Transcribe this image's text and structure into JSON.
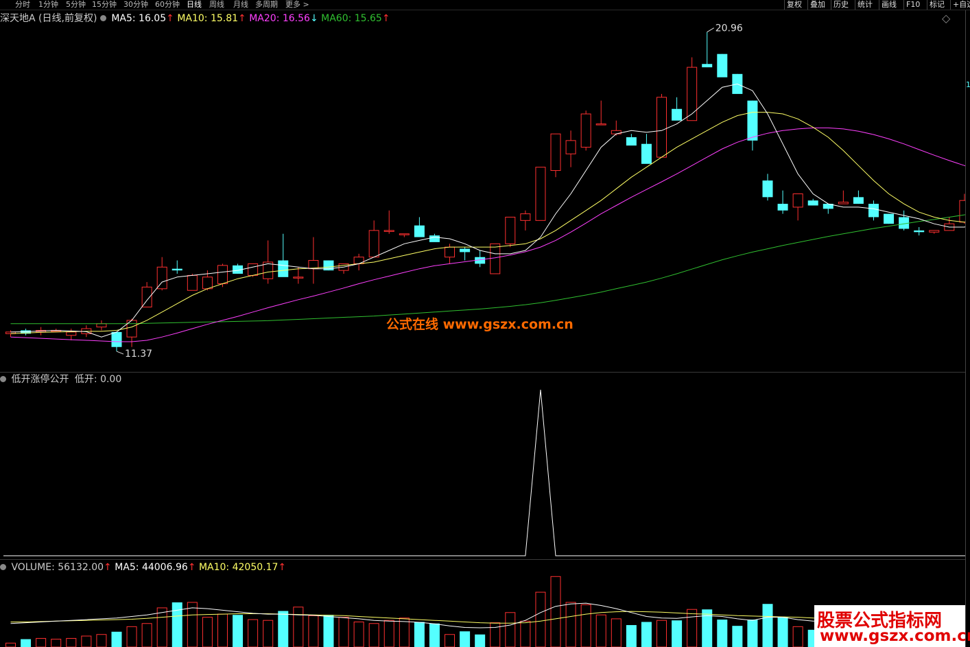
{
  "topbar": {
    "tabs": [
      "分时",
      "1分钟",
      "5分钟",
      "15分钟",
      "30分钟",
      "60分钟",
      "日线",
      "周线",
      "月线",
      "多周期",
      "更多 >"
    ],
    "active_tab": "日线",
    "right_buttons": [
      "复权",
      "叠加",
      "历史",
      "统计",
      "画线",
      "F10",
      "标记",
      "+自选"
    ],
    "diamond_icon": "◇"
  },
  "main_panel": {
    "stock_title": "深天地A (日线,前复权)",
    "ma5_label": "MA5: 16.05",
    "ma10_label": "MA10: 15.81",
    "ma20_label": "MA20: 16.56",
    "ma60_label": "MA60: 15.65",
    "up_arrow": "↑",
    "down_arrow": "↓",
    "high_label": "20.96",
    "low_label": "11.37",
    "colors": {
      "ma5": "#ffffff",
      "ma10": "#ffff66",
      "ma20": "#ff40ff",
      "ma60": "#30c030",
      "up": "#ff3030",
      "down": "#54ffff"
    }
  },
  "indicator_panel": {
    "title": "低开涨停公开",
    "value_label": "低开: 0.00"
  },
  "volume_panel": {
    "volume_label": "VOLUME: 56132.00",
    "ma5_label": "MA5: 44006.96",
    "ma10_label": "MA10: 42050.17"
  },
  "right_axis_mark": "1",
  "watermarks": {
    "center": "公式在线  www.gszx.com.cn",
    "corner_line1": "股票公式指标网",
    "corner_line2": "www.gszx.com.cn"
  },
  "chart_data": {
    "type": "candlestick",
    "price_range": [
      11.0,
      21.2
    ],
    "candles": [
      [
        11.9,
        12.0,
        11.8,
        11.95
      ],
      [
        12.0,
        12.05,
        11.85,
        11.9
      ],
      [
        11.95,
        12.1,
        11.85,
        12.0
      ],
      [
        12.0,
        12.05,
        11.95,
        12.0
      ],
      [
        11.85,
        12.05,
        11.7,
        11.95
      ],
      [
        11.9,
        12.15,
        11.8,
        12.05
      ],
      [
        12.1,
        12.3,
        12.0,
        12.2
      ],
      [
        11.95,
        11.95,
        11.37,
        11.5
      ],
      [
        11.8,
        12.35,
        11.5,
        12.3
      ],
      [
        12.7,
        13.45,
        12.7,
        13.3
      ],
      [
        13.25,
        14.2,
        13.2,
        13.9
      ],
      [
        13.85,
        14.1,
        13.7,
        13.8
      ],
      [
        13.2,
        13.7,
        13.2,
        13.65
      ],
      [
        13.25,
        13.8,
        13.2,
        13.6
      ],
      [
        13.4,
        14.0,
        13.3,
        13.95
      ],
      [
        13.95,
        14.0,
        13.7,
        13.7
      ],
      [
        13.65,
        14.0,
        13.6,
        14.0
      ],
      [
        13.55,
        14.7,
        13.4,
        14.05
      ],
      [
        14.1,
        14.9,
        13.8,
        13.6
      ],
      [
        13.6,
        13.9,
        13.4,
        13.6
      ],
      [
        13.85,
        14.8,
        13.4,
        14.1
      ],
      [
        14.1,
        14.1,
        13.8,
        13.8
      ],
      [
        13.8,
        14.0,
        13.7,
        14.0
      ],
      [
        14.0,
        14.3,
        13.8,
        14.2
      ],
      [
        14.2,
        15.3,
        14.2,
        15.0
      ],
      [
        15.0,
        15.6,
        14.9,
        15.0
      ],
      [
        14.9,
        14.9,
        14.8,
        14.9
      ],
      [
        15.15,
        15.4,
        15.1,
        14.8
      ],
      [
        14.85,
        14.9,
        14.7,
        14.65
      ],
      [
        14.2,
        14.6,
        14.0,
        14.5
      ],
      [
        14.45,
        14.5,
        14.1,
        14.35
      ],
      [
        14.2,
        14.4,
        13.9,
        14.0
      ],
      [
        13.7,
        14.6,
        13.7,
        14.6
      ],
      [
        14.6,
        15.4,
        14.5,
        15.4
      ],
      [
        15.3,
        15.6,
        15.0,
        15.5
      ],
      [
        15.3,
        16.8,
        15.3,
        16.9
      ],
      [
        16.8,
        17.9,
        16.6,
        17.9
      ],
      [
        17.3,
        18.0,
        16.9,
        17.7
      ],
      [
        17.5,
        18.6,
        17.4,
        18.5
      ],
      [
        18.2,
        18.9,
        18.2,
        18.2
      ],
      [
        17.9,
        18.3,
        17.85,
        18.0
      ],
      [
        17.8,
        17.9,
        17.75,
        17.55
      ],
      [
        17.6,
        17.9,
        17.4,
        17.0
      ],
      [
        17.2,
        19.1,
        17.2,
        19.0
      ],
      [
        18.65,
        19.0,
        18.65,
        18.3
      ],
      [
        18.3,
        20.2,
        18.3,
        19.9
      ],
      [
        20.0,
        20.96,
        19.9,
        19.9
      ],
      [
        20.3,
        20.3,
        20.1,
        19.6
      ],
      [
        19.7,
        19.7,
        19.2,
        19.1
      ],
      [
        18.9,
        18.9,
        17.4,
        17.7
      ],
      [
        16.5,
        16.7,
        15.9,
        16.0
      ],
      [
        15.8,
        16.2,
        15.5,
        15.6
      ],
      [
        15.7,
        16.1,
        15.3,
        16.1
      ],
      [
        15.9,
        15.95,
        15.75,
        15.75
      ],
      [
        15.8,
        15.8,
        15.5,
        15.65
      ],
      [
        15.8,
        16.2,
        15.8,
        15.85
      ],
      [
        16.0,
        16.2,
        15.8,
        15.8
      ],
      [
        15.8,
        15.9,
        15.3,
        15.4
      ],
      [
        15.5,
        15.5,
        15.2,
        15.2
      ],
      [
        15.4,
        15.6,
        15.0,
        15.05
      ],
      [
        15.0,
        15.1,
        14.85,
        14.95
      ],
      [
        14.95,
        15.0,
        14.9,
        15.0
      ],
      [
        15.0,
        15.4,
        15.0,
        15.2
      ],
      [
        15.25,
        16.1,
        15.2,
        15.9
      ],
      [
        16.1,
        16.5,
        16.1,
        16.5
      ],
      [
        16.5,
        17.0,
        15.9,
        15.9
      ]
    ],
    "ma5": [
      11.95,
      11.96,
      11.98,
      12.0,
      11.98,
      11.96,
      11.8,
      11.95,
      12.3,
      12.9,
      13.45,
      13.6,
      13.65,
      13.7,
      13.75,
      13.8,
      13.9,
      14.0,
      13.95,
      13.9,
      13.85,
      13.85,
      13.9,
      14.0,
      14.2,
      14.4,
      14.6,
      14.7,
      14.8,
      14.75,
      14.6,
      14.4,
      14.3,
      14.3,
      14.4,
      14.8,
      15.5,
      16.1,
      16.8,
      17.5,
      17.9,
      18.0,
      17.95,
      18.0,
      18.2,
      18.5,
      18.9,
      19.3,
      19.4,
      19.2,
      18.5,
      17.6,
      16.7,
      16.1,
      15.8,
      15.7,
      15.7,
      15.65,
      15.55,
      15.45,
      15.35,
      15.2,
      15.1,
      15.1,
      15.3,
      15.6
    ],
    "ma10": [
      11.9,
      11.92,
      11.94,
      11.95,
      11.96,
      11.97,
      11.97,
      12.0,
      12.1,
      12.3,
      12.55,
      12.8,
      13.05,
      13.25,
      13.4,
      13.55,
      13.65,
      13.75,
      13.8,
      13.85,
      13.87,
      13.9,
      13.95,
      14.0,
      14.05,
      14.15,
      14.25,
      14.35,
      14.45,
      14.5,
      14.5,
      14.5,
      14.5,
      14.55,
      14.6,
      14.75,
      15.0,
      15.3,
      15.6,
      15.9,
      16.25,
      16.6,
      16.9,
      17.2,
      17.5,
      17.75,
      18.0,
      18.25,
      18.45,
      18.55,
      18.55,
      18.5,
      18.35,
      18.1,
      17.8,
      17.4,
      16.95,
      16.5,
      16.1,
      15.8,
      15.55,
      15.4,
      15.3,
      15.25,
      15.25,
      15.3
    ],
    "ma20": [
      11.8,
      11.78,
      11.76,
      11.74,
      11.72,
      11.7,
      11.68,
      11.66,
      11.66,
      11.7,
      11.8,
      11.92,
      12.05,
      12.18,
      12.3,
      12.42,
      12.55,
      12.68,
      12.8,
      12.92,
      13.03,
      13.15,
      13.27,
      13.4,
      13.52,
      13.63,
      13.74,
      13.85,
      13.94,
      14.0,
      14.06,
      14.12,
      14.18,
      14.26,
      14.36,
      14.5,
      14.7,
      14.95,
      15.22,
      15.5,
      15.75,
      16.0,
      16.23,
      16.46,
      16.7,
      16.95,
      17.2,
      17.45,
      17.65,
      17.8,
      17.92,
      18.0,
      18.05,
      18.08,
      18.08,
      18.05,
      17.98,
      17.88,
      17.75,
      17.6,
      17.43,
      17.26,
      17.1,
      16.95,
      16.78,
      16.6
    ],
    "ma60": [
      12.2,
      12.2,
      12.2,
      12.2,
      12.2,
      12.2,
      12.2,
      12.2,
      12.2,
      12.21,
      12.22,
      12.23,
      12.24,
      12.25,
      12.26,
      12.27,
      12.28,
      12.29,
      12.31,
      12.33,
      12.35,
      12.37,
      12.39,
      12.41,
      12.43,
      12.46,
      12.49,
      12.52,
      12.55,
      12.58,
      12.61,
      12.64,
      12.68,
      12.72,
      12.77,
      12.83,
      12.9,
      12.98,
      13.06,
      13.15,
      13.25,
      13.35,
      13.45,
      13.57,
      13.7,
      13.84,
      13.98,
      14.12,
      14.24,
      14.35,
      14.45,
      14.55,
      14.64,
      14.73,
      14.82,
      14.9,
      14.98,
      15.06,
      15.13,
      15.2,
      15.27,
      15.33,
      15.4,
      15.47,
      15.55,
      15.65
    ],
    "indicator": [
      0,
      0,
      0,
      0,
      0,
      0,
      0,
      0,
      0,
      0,
      0,
      0,
      0,
      0,
      0,
      0,
      0,
      0,
      0,
      0,
      0,
      0,
      0,
      0,
      0,
      0,
      0,
      0,
      0,
      0,
      0,
      0,
      0,
      0,
      0,
      1,
      0,
      0,
      0,
      0,
      0,
      0,
      0,
      0,
      0,
      0,
      0,
      0,
      0,
      0,
      0,
      0,
      0,
      0,
      0,
      0,
      0,
      0,
      0,
      0,
      0,
      0,
      0,
      0,
      0,
      0
    ],
    "volume": [
      5000,
      10000,
      11000,
      10000,
      11000,
      14000,
      16000,
      19500,
      26000,
      30000,
      50000,
      57000,
      57000,
      38000,
      42000,
      41000,
      35000,
      34000,
      46000,
      51000,
      40000,
      41000,
      38000,
      32000,
      30000,
      34000,
      37000,
      32000,
      30000,
      16000,
      20000,
      16000,
      31000,
      44000,
      33000,
      70000,
      90000,
      57000,
      54000,
      41000,
      36000,
      28000,
      32000,
      34000,
      34000,
      48000,
      48000,
      35000,
      27000,
      35000,
      55000,
      38000,
      26000,
      22000,
      33000,
      33000,
      22000,
      30000,
      28000,
      24000,
      20000,
      18000,
      22000,
      30000,
      40000,
      56132
    ],
    "volume_ma5": [
      30000,
      31000,
      32000,
      33000,
      34000,
      35000,
      36000,
      37000,
      39000,
      41000,
      44000,
      47000,
      50000,
      49000,
      47000,
      45000,
      43000,
      42000,
      42000,
      41000,
      40500,
      39000,
      37500,
      36000,
      34000,
      33000,
      32500,
      31500,
      29500,
      27000,
      25000,
      24500,
      25000,
      28000,
      34000,
      44000,
      52000,
      55000,
      56000,
      53000,
      49000,
      44000,
      39000,
      37000,
      36500,
      38500,
      40000,
      39000,
      36000,
      34000,
      38000,
      38000,
      35000,
      33000,
      33000,
      32000,
      29000,
      28000,
      27000,
      26000,
      24500,
      23500,
      24000,
      26500,
      29000,
      44007
    ],
    "volume_ma10": [
      32000,
      32000,
      32500,
      33000,
      33500,
      34000,
      34500,
      35000,
      35500,
      36500,
      38000,
      39500,
      41000,
      41500,
      42000,
      42500,
      42500,
      42500,
      42000,
      41500,
      41000,
      40500,
      40000,
      39000,
      38000,
      37000,
      36000,
      35000,
      34000,
      33000,
      32000,
      31000,
      30500,
      30500,
      31000,
      33000,
      36000,
      39000,
      42000,
      44000,
      45000,
      45500,
      45000,
      44500,
      43500,
      42500,
      42000,
      41000,
      40000,
      39500,
      39000,
      38500,
      38000,
      37000,
      36000,
      35500,
      34500,
      33500,
      32500,
      31500,
      30500,
      29500,
      28500,
      28000,
      30000,
      42050
    ]
  }
}
